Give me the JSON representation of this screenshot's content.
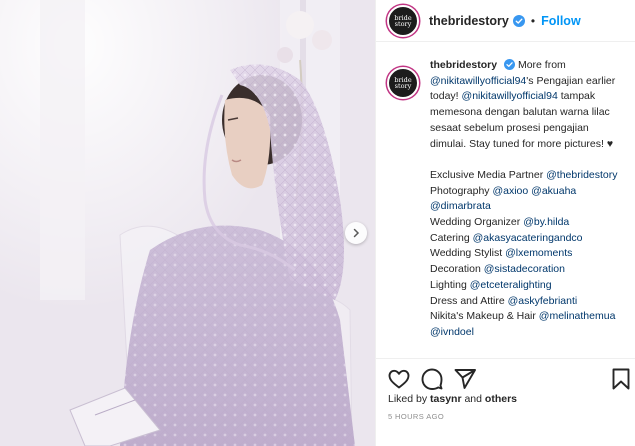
{
  "post": {
    "username": "thebridestory",
    "avatar_text": "bride story",
    "follow_label": "Follow",
    "header_separator": "•"
  },
  "caption": {
    "username": "thebridestory",
    "text_1": "More from",
    "mention_1": "@nikitawillyofficial94",
    "text_2": "'s Pengajian earlier today!",
    "mention_2": "@nikitawillyofficial94",
    "text_3": "tampak memesona dengan balutan warna lilac sesaat sebelum prosesi pengajian dimulai. Stay tuned for more pictures! ♥",
    "credits": [
      {
        "label": "Exclusive Media Partner",
        "mentions": [
          "@thebridestory"
        ]
      },
      {
        "label": "Photography",
        "mentions": [
          "@axioo",
          "@akuaha",
          "@dimarbrata"
        ]
      },
      {
        "label": "Wedding Organizer",
        "mentions": [
          "@by.hilda"
        ]
      },
      {
        "label": "Catering",
        "mentions": [
          "@akasyacateringandco"
        ]
      },
      {
        "label": "Wedding Stylist",
        "mentions": [
          "@lxemoments"
        ]
      },
      {
        "label": "Decoration",
        "mentions": [
          "@sistadecoration"
        ]
      },
      {
        "label": "Lighting",
        "mentions": [
          "@etceteralighting"
        ]
      },
      {
        "label": "Dress and Attire",
        "mentions": [
          "@askyfebrianti"
        ]
      },
      {
        "label": "Nikita's Makeup & Hair",
        "mentions": [
          "@melinathemua",
          "@ivndoel"
        ]
      }
    ]
  },
  "engagement": {
    "liked_by_prefix": "Liked by",
    "liked_by_user": "tasynr",
    "liked_by_and": "and",
    "liked_by_others": "others",
    "timestamp": "5 HOURS AGO"
  },
  "icons": {
    "like": "heart-icon",
    "comment": "comment-icon",
    "share": "paper-plane-icon",
    "save": "bookmark-icon",
    "verified": "verified-badge-icon",
    "carousel_next": "chevron-right-icon"
  },
  "colors": {
    "link": "#00376b",
    "follow": "#0095f6",
    "verified": "#3897f0",
    "muted": "#8e8e8e",
    "lilac": "#d9cbe3"
  }
}
